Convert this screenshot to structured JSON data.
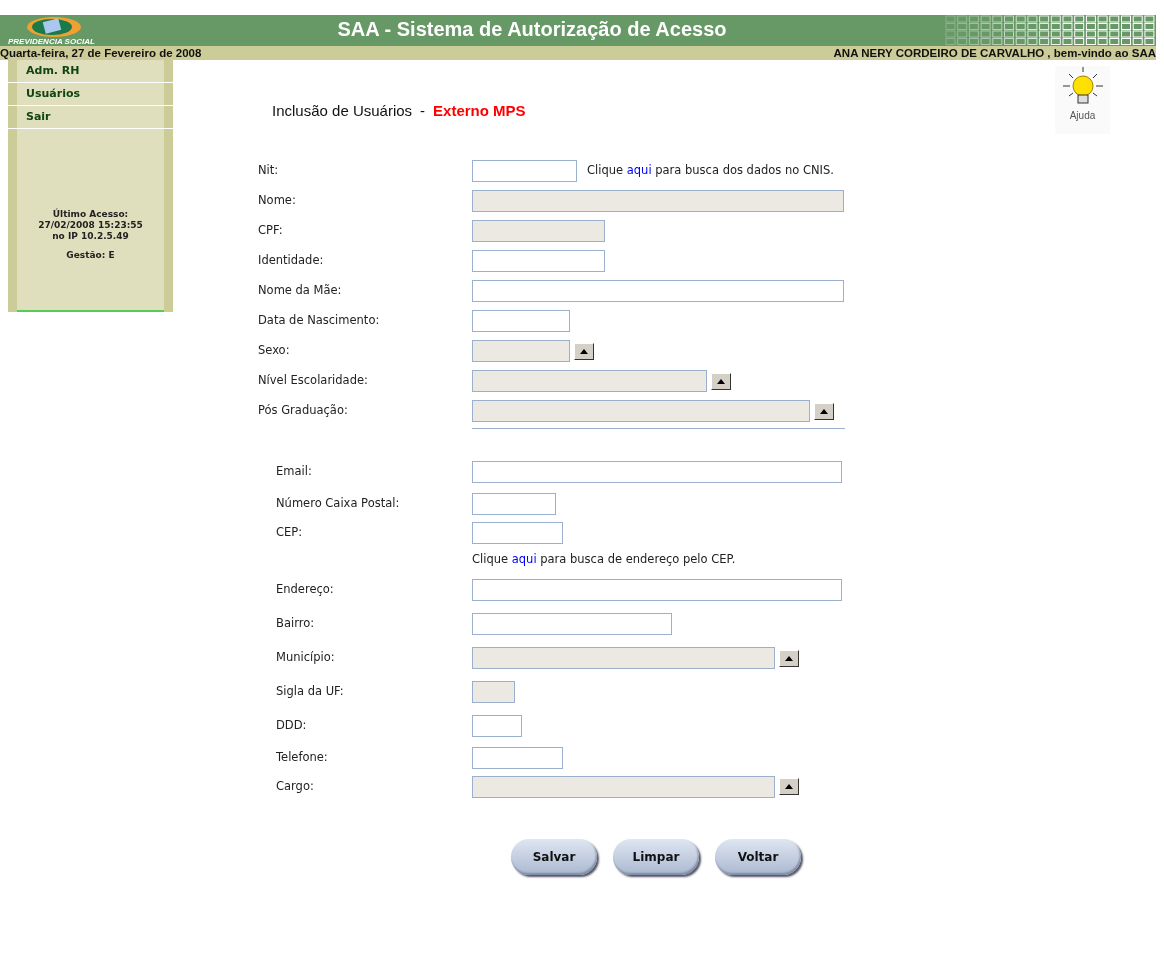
{
  "header": {
    "logo_caption": "PREVIDENCIA SOCIAL",
    "title": "SAA - Sistema de Autorização de Acesso"
  },
  "info_bar": {
    "date": "Quarta-feira, 27 de Fevereiro de 2008",
    "welcome": "ANA NERY CORDEIRO DE CARVALHO , bem-vindo ao SAA"
  },
  "sidebar": {
    "items": [
      {
        "label": "Adm. RH"
      },
      {
        "label": "Usuários"
      },
      {
        "label": "Sair"
      }
    ],
    "last_access": [
      "Último Acesso:",
      "27/02/2008 15:23:55",
      "no IP 10.2.5.49"
    ],
    "management": "Gestão: E"
  },
  "page": {
    "title": "Inclusão de Usuários",
    "separator": "-",
    "subtitle": "Externo MPS",
    "help": "Ajuda"
  },
  "form_sections": [
    {
      "fields": [
        {
          "label": "Nit:",
          "kind": "text",
          "disabled": false,
          "hint": {
            "before": "Clique",
            "link": "aqui",
            "after": "para busca dos dados no CNIS."
          }
        },
        {
          "label": "Nome:",
          "kind": "text",
          "disabled": true
        },
        {
          "label": "CPF:",
          "kind": "text",
          "disabled": true
        },
        {
          "label": "Identidade:",
          "kind": "text",
          "disabled": false
        },
        {
          "label": "Nome da Mãe:",
          "kind": "text",
          "disabled": false
        },
        {
          "label": "Data de Nascimento:",
          "kind": "text",
          "disabled": false
        },
        {
          "label": "Sexo:",
          "kind": "select",
          "disabled": true
        },
        {
          "label": "Nível Escolaridade:",
          "kind": "select",
          "disabled": true
        },
        {
          "label": "Pós Graduação:",
          "kind": "select",
          "disabled": true
        }
      ]
    },
    {
      "fields": [
        {
          "label": "Email:",
          "kind": "text",
          "disabled": false
        },
        {
          "label": "Número Caixa Postal:",
          "kind": "text",
          "disabled": false
        },
        {
          "label": "CEP:",
          "kind": "text",
          "disabled": false,
          "hint_below": {
            "before": "Clique",
            "link": "aqui",
            "after": "para busca de endereço pelo CEP."
          }
        },
        {
          "label": "Endereço:",
          "kind": "text",
          "disabled": false
        },
        {
          "label": "Bairro:",
          "kind": "text",
          "disabled": false
        },
        {
          "label": "Município:",
          "kind": "select",
          "disabled": true
        },
        {
          "label": "Sigla da UF:",
          "kind": "text",
          "disabled": true
        },
        {
          "label": "DDD:",
          "kind": "text",
          "disabled": false
        },
        {
          "label": "Telefone:",
          "kind": "text",
          "disabled": false
        },
        {
          "label": "Cargo:",
          "kind": "select",
          "disabled": true
        }
      ]
    }
  ],
  "buttons": [
    "Salvar",
    "Limpar",
    "Voltar"
  ]
}
